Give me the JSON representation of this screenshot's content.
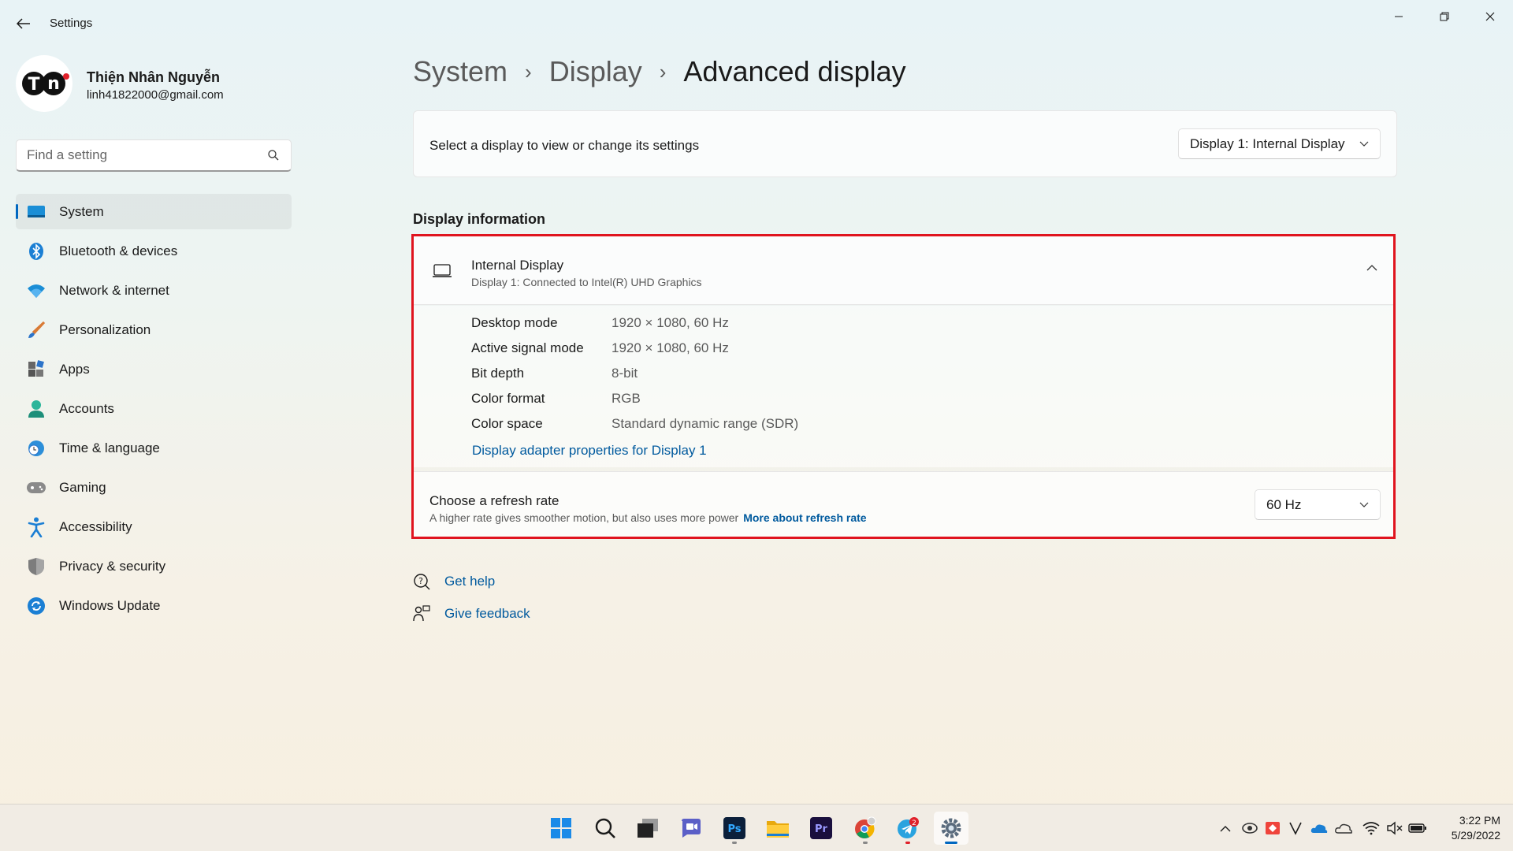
{
  "window": {
    "title": "Settings",
    "controls": {
      "minimize": "minimize-icon",
      "maximize": "restore-icon",
      "close": "close-icon"
    }
  },
  "profile": {
    "name": "Thiện Nhân Nguyễn",
    "email": "linh41822000@gmail.com",
    "avatar_initials": "TN"
  },
  "search": {
    "placeholder": "Find a setting"
  },
  "nav": {
    "items": [
      {
        "label": "System",
        "icon": "system-icon",
        "active": true
      },
      {
        "label": "Bluetooth & devices",
        "icon": "bluetooth-icon"
      },
      {
        "label": "Network & internet",
        "icon": "wifi-icon"
      },
      {
        "label": "Personalization",
        "icon": "brush-icon"
      },
      {
        "label": "Apps",
        "icon": "apps-icon"
      },
      {
        "label": "Accounts",
        "icon": "person-icon"
      },
      {
        "label": "Time & language",
        "icon": "clock-globe-icon"
      },
      {
        "label": "Gaming",
        "icon": "gamepad-icon"
      },
      {
        "label": "Accessibility",
        "icon": "accessibility-icon"
      },
      {
        "label": "Privacy & security",
        "icon": "shield-icon"
      },
      {
        "label": "Windows Update",
        "icon": "update-icon"
      }
    ]
  },
  "breadcrumb": {
    "items": [
      "System",
      "Display"
    ],
    "current": "Advanced display"
  },
  "display_select": {
    "label": "Select a display to view or change its settings",
    "value": "Display 1: Internal Display"
  },
  "display_info": {
    "section_title": "Display information",
    "title": "Internal Display",
    "subtitle": "Display 1: Connected to Intel(R) UHD Graphics",
    "rows": [
      {
        "key": "Desktop mode",
        "value": "1920 × 1080, 60 Hz"
      },
      {
        "key": "Active signal mode",
        "value": "1920 × 1080, 60 Hz"
      },
      {
        "key": "Bit depth",
        "value": "8-bit"
      },
      {
        "key": "Color format",
        "value": "RGB"
      },
      {
        "key": "Color space",
        "value": "Standard dynamic range (SDR)"
      }
    ],
    "adapter_link": "Display adapter properties for Display 1"
  },
  "refresh_rate": {
    "title": "Choose a refresh rate",
    "description": "A higher rate gives smoother motion, but also uses more power",
    "link": "More about refresh rate",
    "value": "60 Hz"
  },
  "help": {
    "get_help": "Get help",
    "give_feedback": "Give feedback"
  },
  "taskbar": {
    "apps": [
      {
        "name": "start-icon"
      },
      {
        "name": "search-icon"
      },
      {
        "name": "task-view-icon"
      },
      {
        "name": "chat-icon"
      },
      {
        "name": "photoshop-icon",
        "label": "Ps"
      },
      {
        "name": "file-explorer-icon"
      },
      {
        "name": "premiere-icon",
        "label": "Pr"
      },
      {
        "name": "chrome-icon"
      },
      {
        "name": "telegram-icon",
        "badge": "2"
      },
      {
        "name": "settings-icon"
      }
    ],
    "tray": [
      "chevron-up-icon",
      "app-tray-icon",
      "anydesk-icon",
      "v-icon",
      "onedrive-icon",
      "cloud-icon",
      "wifi-icon",
      "mute-icon",
      "battery-icon"
    ],
    "time": "3:22 PM",
    "date": "5/29/2022"
  },
  "colors": {
    "accent": "#0067c0",
    "link": "#005a9e",
    "highlight_border": "#e0141e"
  }
}
